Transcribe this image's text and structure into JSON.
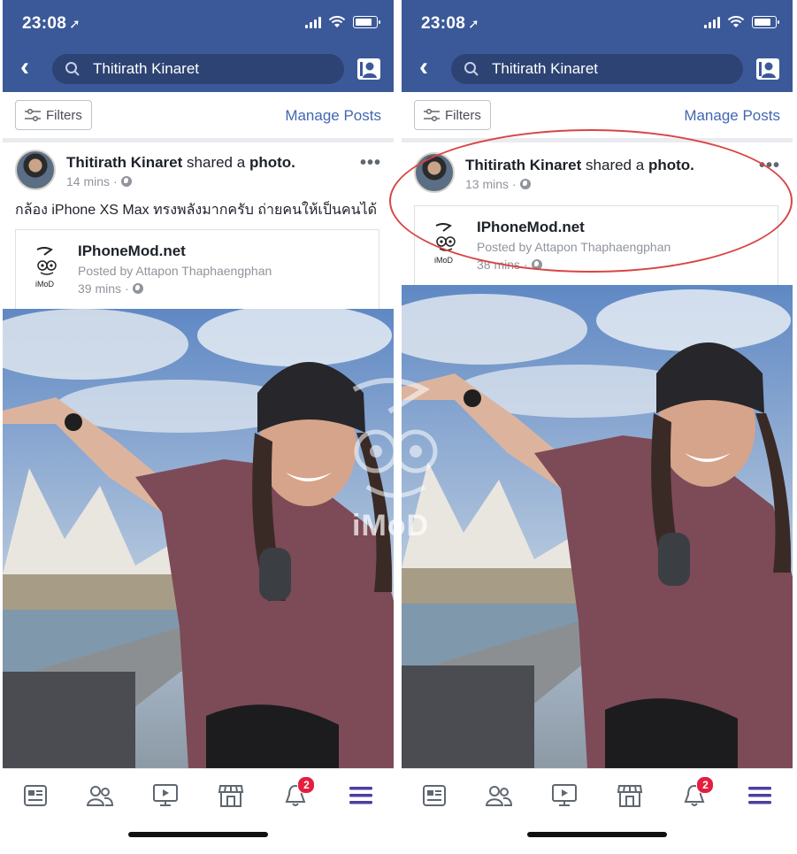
{
  "status": {
    "time": "23:08"
  },
  "search": {
    "value": "Thitirath Kinaret"
  },
  "filters_label": "Filters",
  "manage_posts_label": "Manage Posts",
  "left_post": {
    "author": "Thitirath Kinaret",
    "action": "shared a",
    "object": "photo.",
    "time": "14 mins",
    "text": "กล้อง iPhone XS Max ทรงพลังมากครับ ถ่ายคนให้เป็นคนได้",
    "shared": {
      "title": "IPhoneMod.net",
      "posted_by": "Posted by Attapon Thaphaengphan",
      "time": "39 mins"
    }
  },
  "right_post": {
    "author": "Thitirath Kinaret",
    "action": "shared a",
    "object": "photo.",
    "time": "13 mins",
    "shared": {
      "title": "IPhoneMod.net",
      "posted_by": "Posted by Attapon Thaphaengphan",
      "time": "38 mins"
    }
  },
  "notifications_badge": "2",
  "tabs": [
    "news-feed-icon",
    "friends-icon",
    "watch-icon",
    "marketplace-icon",
    "notifications-icon",
    "menu-icon"
  ],
  "watermark_text": "iMoD",
  "colors": {
    "header": "#3b5998",
    "link": "#4267b2",
    "badge": "#e41e3f",
    "highlight": "#d94545"
  }
}
